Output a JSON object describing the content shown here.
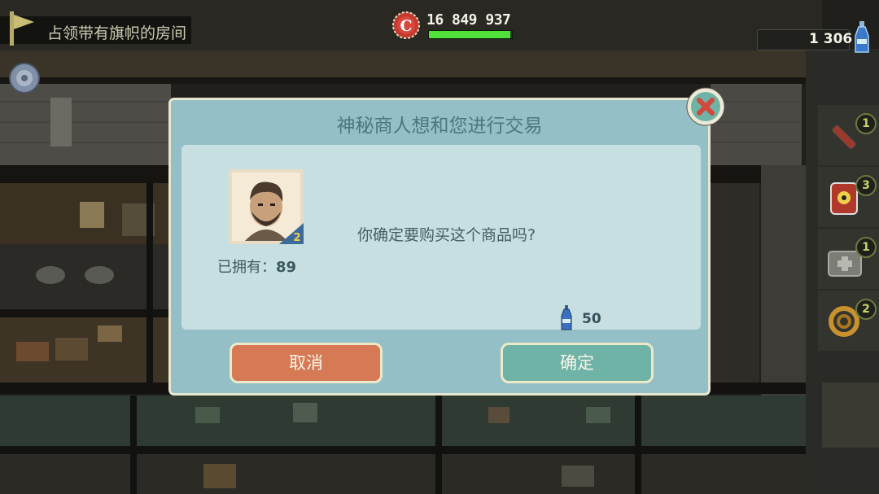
{
  "hud": {
    "quest_text": "占领带有旗帜的房间",
    "caps": "16 849 937",
    "health_fraction": 0.98,
    "nuka_quantum": "1 306"
  },
  "side_items": [
    {
      "icon": "stimpak-icon",
      "count": "1"
    },
    {
      "icon": "radaway-icon",
      "count": "3"
    },
    {
      "icon": "first-aid-kit-icon",
      "count": "1"
    },
    {
      "icon": "rope-icon",
      "count": "2"
    }
  ],
  "dialog": {
    "title": "神秘商人想和您进行交易",
    "portrait_level": "2",
    "owned_label": "已拥有：",
    "owned_count": "89",
    "question": "你确定要购买这个商品吗?",
    "price": "50",
    "cancel_label": "取消",
    "confirm_label": "确定"
  },
  "colors": {
    "dialog_bg": "#94bfc6",
    "panel_bg": "#c7dfe1",
    "cancel_bg": "#d57a55",
    "confirm_bg": "#6fb3a6",
    "health": "#4fe03a"
  }
}
